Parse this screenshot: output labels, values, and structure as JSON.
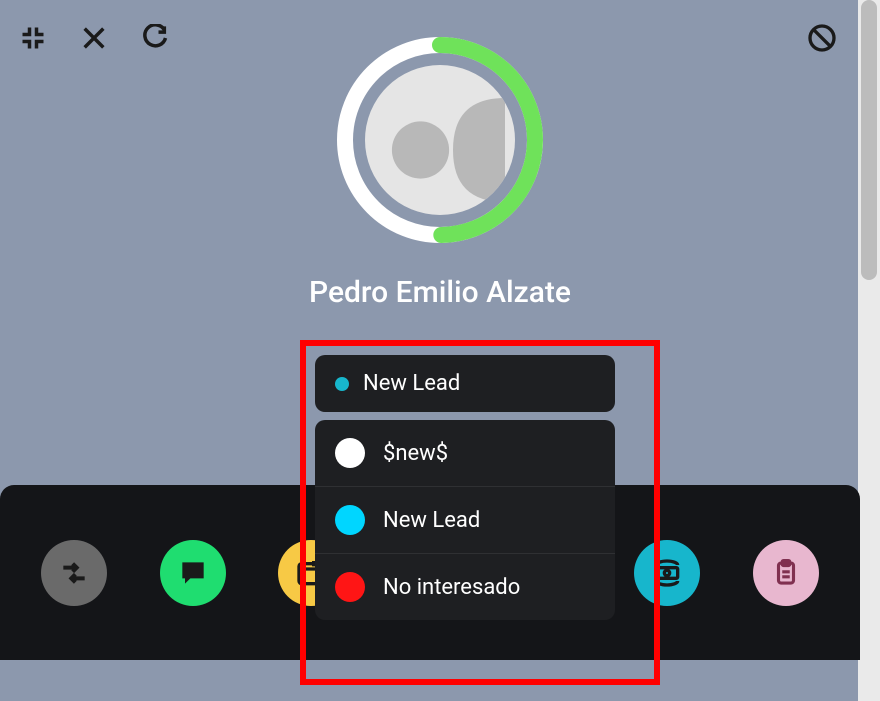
{
  "contact": {
    "name": "Pedro Emilio Alzate"
  },
  "status_dropdown": {
    "selected": {
      "label": "New Lead",
      "color": "cyan"
    },
    "options": [
      {
        "label": "$new$",
        "color": "white"
      },
      {
        "label": "New Lead",
        "color": "aqua"
      },
      {
        "label": "No interesado",
        "color": "red"
      }
    ]
  },
  "colors": {
    "progress_fill": "#6fe25a",
    "progress_track": "#ffffff",
    "highlight_box": "#ff0000"
  }
}
